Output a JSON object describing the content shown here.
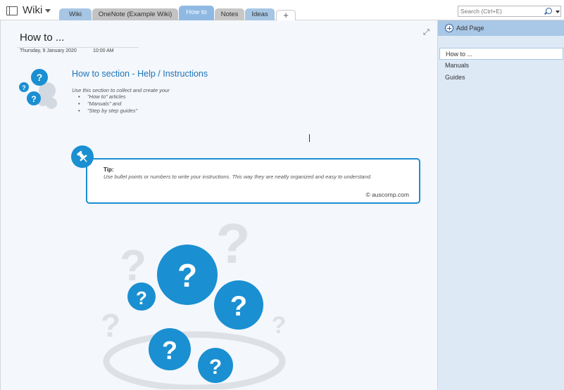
{
  "notebook": {
    "title": "Wiki"
  },
  "tabs": [
    {
      "label": "Wiki"
    },
    {
      "label": "OneNote (Example Wiki)"
    },
    {
      "label": "How to"
    },
    {
      "label": "Notes"
    },
    {
      "label": "Ideas"
    },
    {
      "label": "+"
    }
  ],
  "search": {
    "placeholder": "Search (Ctrl+E)"
  },
  "page": {
    "title": "How to ...",
    "date": "Thursday, 9 January 2020",
    "time": "10:00 AM",
    "section_heading": "How to section - Help / Instructions",
    "intro": "Use this section to collect and create your",
    "bullets": [
      "\"How to\" articles",
      "\"Manuals\" and",
      "\"Step by step guides\""
    ],
    "tip": {
      "label": "Tip:",
      "text": "Use bullet points or numbers to write your instructions. This way they are neatly organized and easy to understand.",
      "credit": "© auscomp.com"
    }
  },
  "sidebar": {
    "add_page_label": "Add Page",
    "pages": [
      {
        "label": "How to ..."
      },
      {
        "label": "Manuals"
      },
      {
        "label": "Guides"
      }
    ]
  },
  "colors": {
    "accent": "#1a8fd1",
    "tab_active": "#8fb9e2",
    "panel_bg": "#dde9f5",
    "heading": "#1e73b8"
  }
}
